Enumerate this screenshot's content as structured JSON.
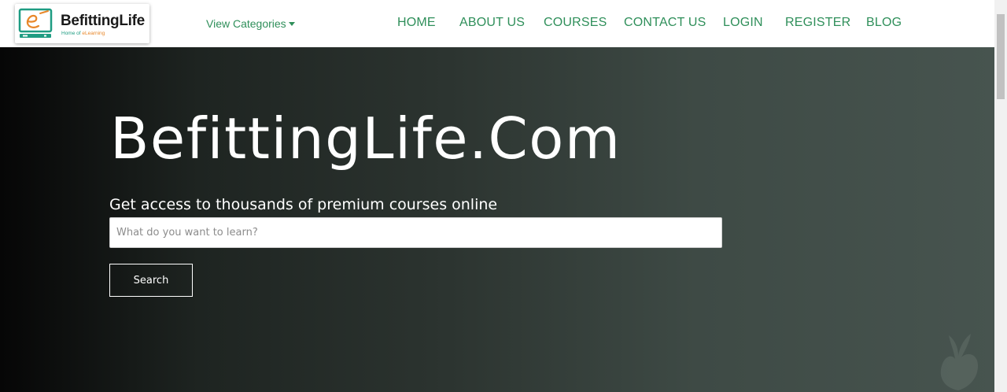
{
  "brand": {
    "name": "BefittingLife",
    "tagline_prefix": "Home of ",
    "tagline_highlight": "eLearning",
    "colors": {
      "teal": "#1e9c82",
      "orange": "#e8872a",
      "nav_green": "#2f8f5a"
    }
  },
  "header": {
    "categories_label": "View Categories",
    "nav": [
      {
        "label": "HOME"
      },
      {
        "label": "ABOUT US"
      },
      {
        "label": "COURSES"
      },
      {
        "label": "CONTACT US"
      },
      {
        "label": "LOGIN"
      },
      {
        "label": "REGISTER"
      },
      {
        "label": "BLOG"
      }
    ]
  },
  "hero": {
    "title": "BefittingLife.Com",
    "subtitle": "Get access to thousands of premium courses online",
    "search": {
      "value": "",
      "placeholder": "What do you want to learn?"
    },
    "search_button_label": "Search"
  },
  "icons": {
    "logo": "monitor-with-e-icon",
    "categories_caret": "caret-down-icon",
    "hero_decoration": "decorative-plant-icon"
  }
}
